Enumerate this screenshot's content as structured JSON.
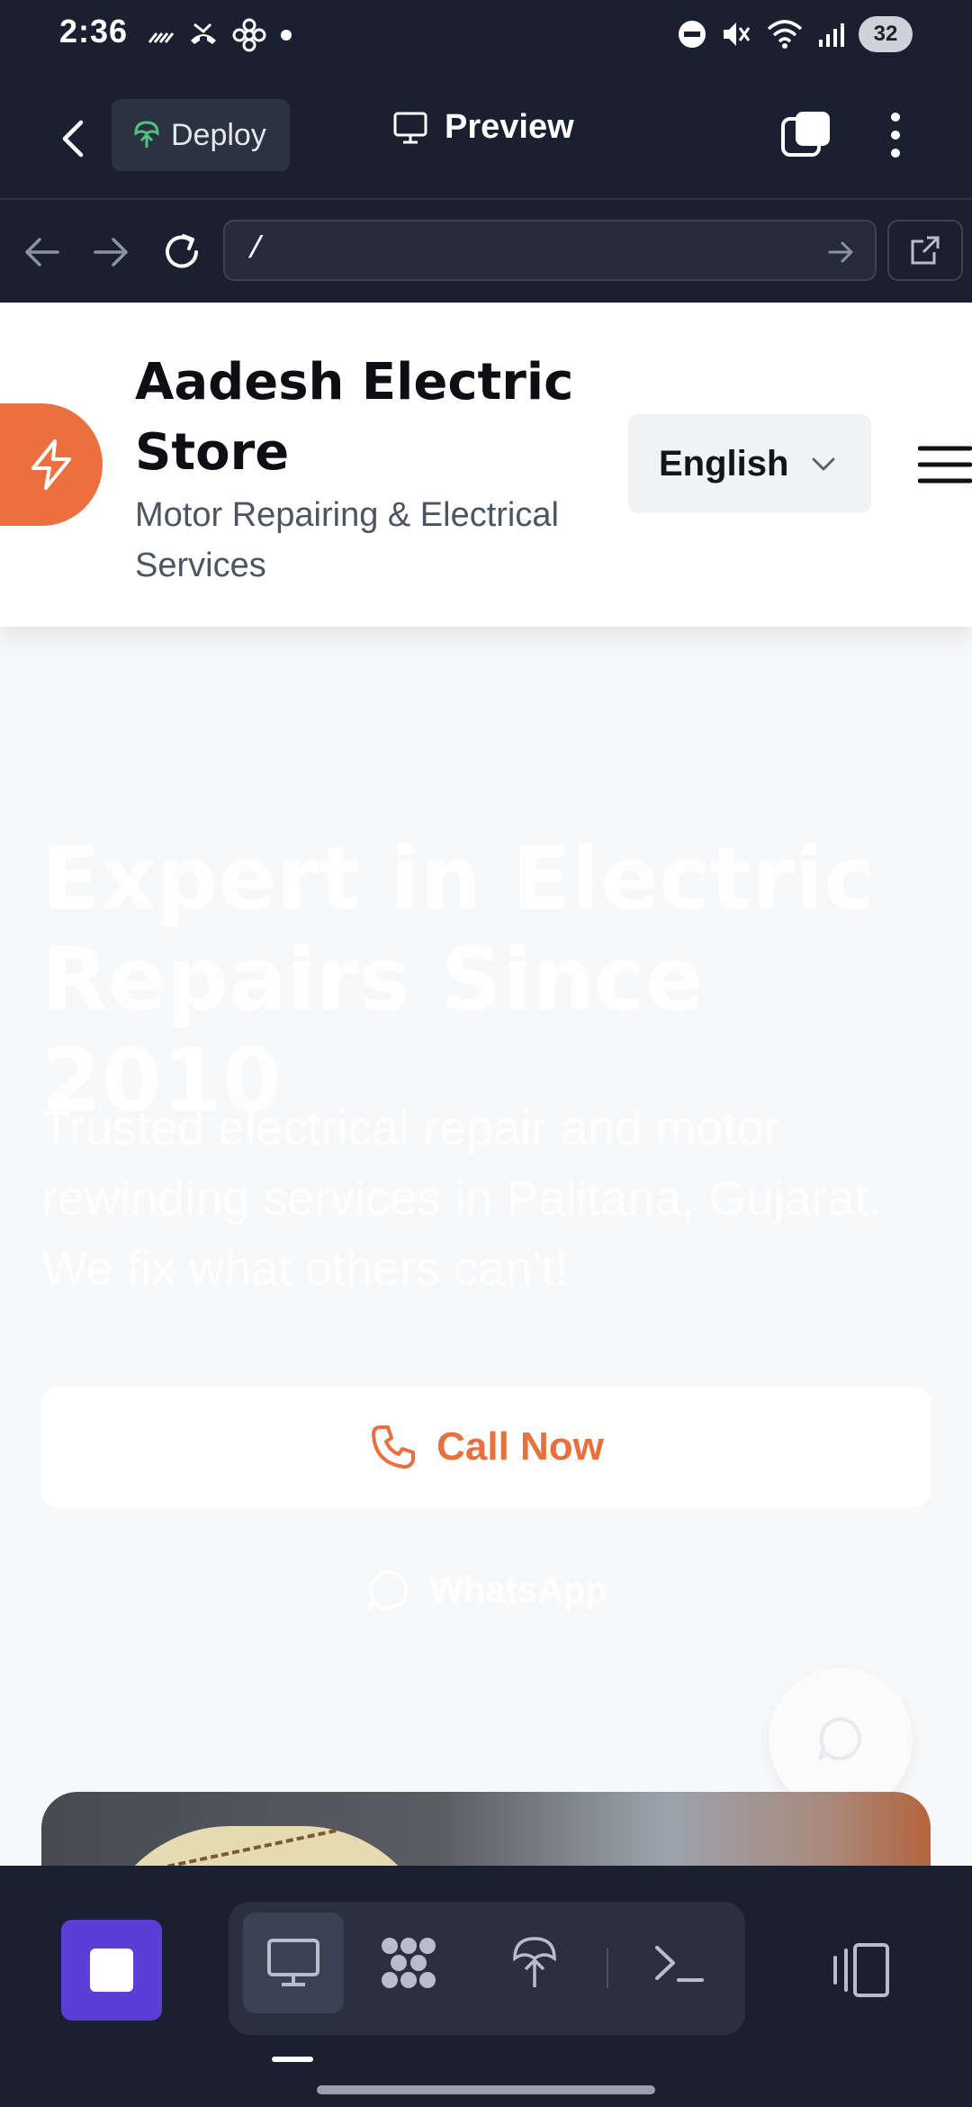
{
  "status_bar": {
    "time": "2:36",
    "battery": "32",
    "icons": [
      "signal-strength-icon",
      "missed-call-icon",
      "fan-icon",
      "notification-dot-icon",
      "dnd-icon",
      "mute-icon",
      "wifi-icon",
      "cell-signal-icon"
    ]
  },
  "app_bar": {
    "deploy_label": "Deploy",
    "preview_label": "Preview"
  },
  "browser": {
    "url": "/"
  },
  "site": {
    "name": "Aadesh Electric Store",
    "tagline": "Motor Repairing & Electrical Services",
    "language": "English",
    "hero_title": "Expert in Electric Repairs Since 2010",
    "hero_subtitle": "Trusted electrical repair and motor rewinding services in Palitana, Gujarat. We fix what others can't!",
    "call_label": "Call Now",
    "whatsapp_label": "WhatsApp"
  },
  "colors": {
    "accent": "#ec6f3f",
    "stop_button": "#5b3ed6",
    "app_background": "#1b2030"
  }
}
